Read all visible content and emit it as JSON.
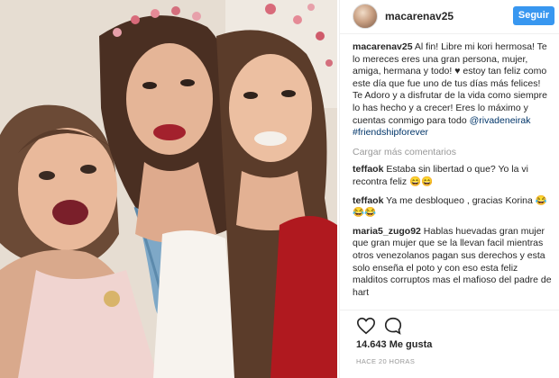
{
  "post": {
    "username": "macarenav25",
    "follow_label": "Seguir",
    "caption": {
      "username": "macarenav25",
      "text": "Al fin! Libre mi kori hermosa! Te lo mereces eres una gran persona, mujer, amiga, hermana y todo! ♥ estoy tan feliz como este día que fue uno de tus días más felices! Te Adoro y a disfrutar de la vida como siempre lo has hecho y a crecer! Eres lo máximo y cuentas conmigo para todo ",
      "mention": "@rivadeneirak",
      "hashtag": "#friendshipforever"
    },
    "load_more_label": "Cargar más comentarios",
    "comments": [
      {
        "username": "teffaok",
        "text": "Estaba sin libertad o que? Yo la vi recontra feliz 😄😄"
      },
      {
        "username": "teffaok",
        "text": "Ya me desbloqueo , gracias Korina 😂😂😂"
      },
      {
        "username": "maria5_zugo92",
        "text": "Hablas huevadas gran mujer que gran mujer que se la llevan facil mientras otros venezolanos pagan sus derechos y esta solo enseña el poto y con eso esta feliz malditos corruptos mas el mafioso del padre de hart"
      }
    ],
    "likes_text": "14.643 Me gusta",
    "time_text": "HACE 20 HORAS"
  },
  "icons": {
    "like": "heart-icon",
    "comment": "comment-bubble-icon"
  },
  "colors": {
    "follow_button": "#3897f0",
    "mention": "#003569",
    "muted": "#999999"
  }
}
